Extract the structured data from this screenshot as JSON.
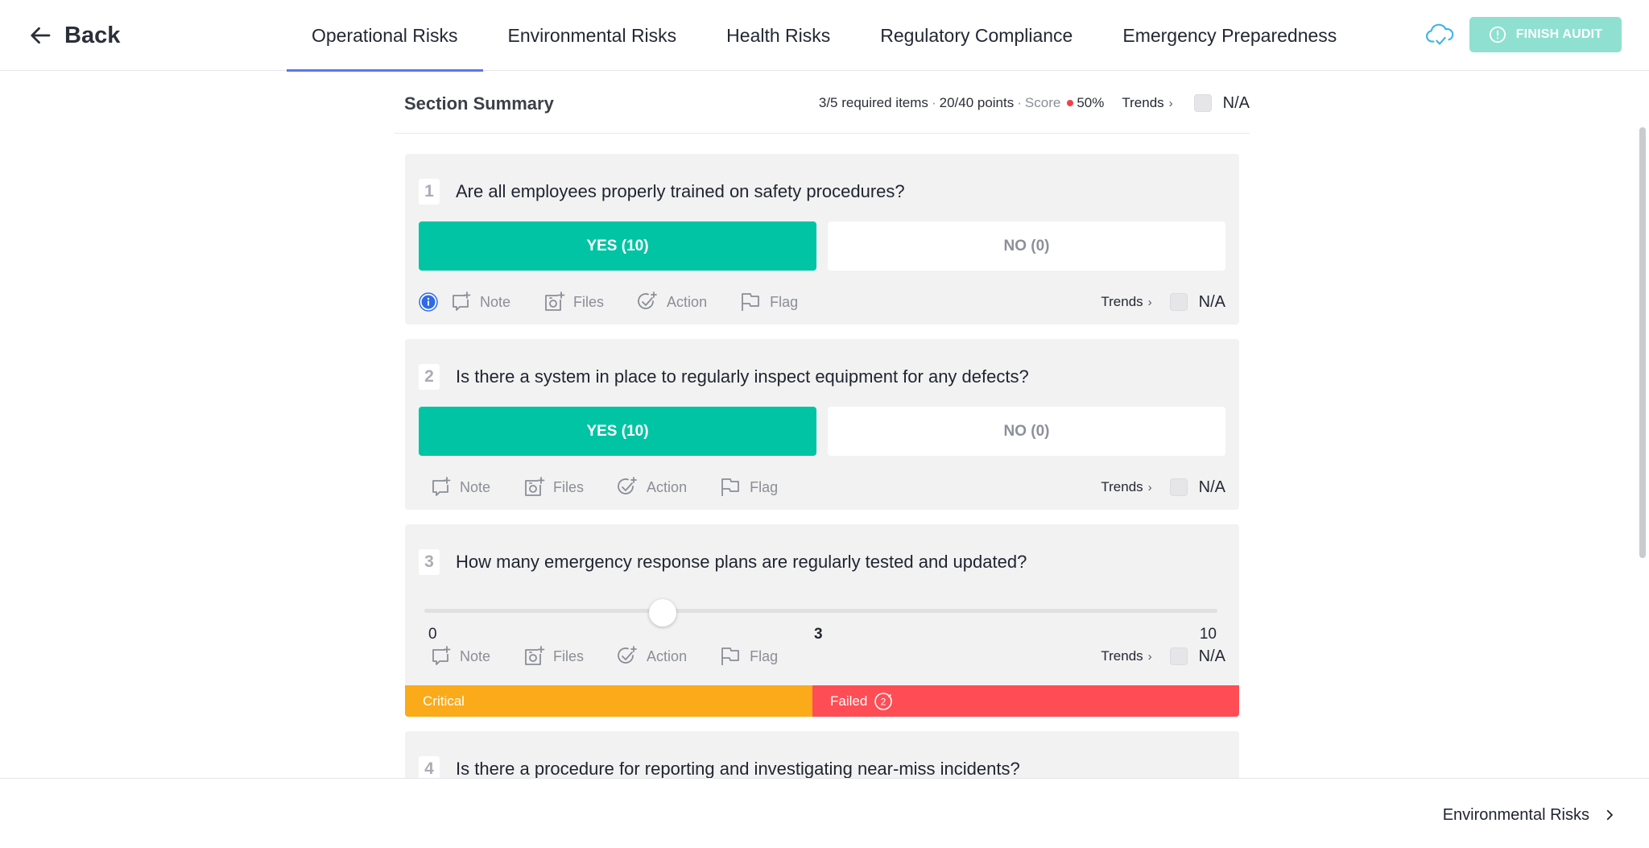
{
  "header": {
    "back_label": "Back",
    "tabs": [
      {
        "label": "Operational Risks",
        "active": true
      },
      {
        "label": "Environmental Risks"
      },
      {
        "label": "Health Risks"
      },
      {
        "label": "Regulatory Compliance"
      },
      {
        "label": "Emergency Preparedness"
      }
    ],
    "finish_label": "FINISH AUDIT"
  },
  "summary": {
    "title": "Section Summary",
    "required": "3/5 required items",
    "points": "20/40 points",
    "score_label": "Score",
    "score_value": "50%",
    "trends_label": "Trends",
    "na_label": "N/A"
  },
  "tools": {
    "note": "Note",
    "files": "Files",
    "action": "Action",
    "flag": "Flag",
    "trends": "Trends",
    "na": "N/A"
  },
  "questions": [
    {
      "number": "1",
      "text": "Are all employees properly trained on safety procedures?",
      "yes": "YES (10)",
      "no": "NO (0)",
      "selected": "yes"
    },
    {
      "number": "2",
      "text": "Is there a system in place to regularly inspect equipment for any defects?",
      "yes": "YES (10)",
      "no": "NO (0)",
      "selected": "yes"
    },
    {
      "number": "3",
      "text": "How many emergency response plans are regularly tested and updated?",
      "min": "0",
      "max": "10",
      "value": "3",
      "status_critical": "Critical",
      "status_failed": "Failed",
      "failed_count": "2"
    },
    {
      "number": "4",
      "text": "Is there a procedure for reporting and investigating near-miss incidents?"
    }
  ],
  "footer": {
    "next_label": "Environmental Risks"
  },
  "colors": {
    "accent": "#00c4a4",
    "tab_underline": "#5b76e8",
    "critical": "#fbaa1a",
    "failed": "#ff4d55",
    "finish_button": "#8fe0d0"
  }
}
